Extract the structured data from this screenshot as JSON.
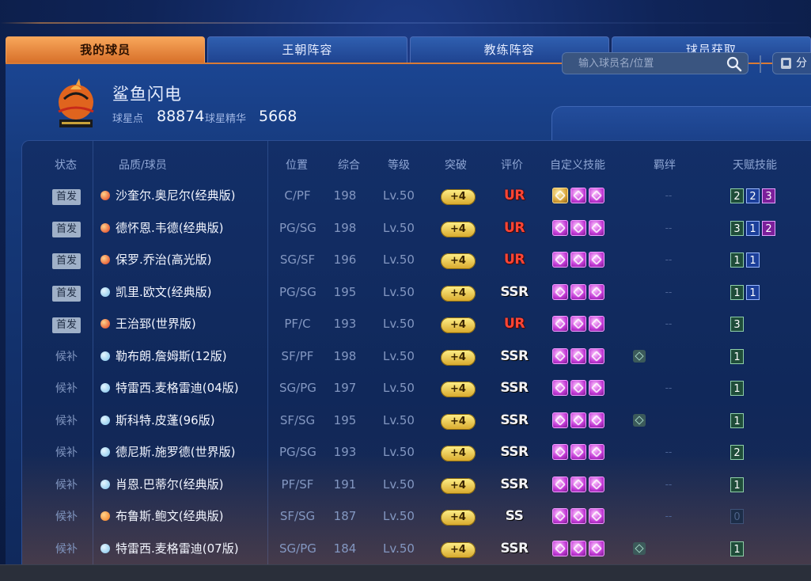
{
  "tabs": [
    {
      "label": "我的球员",
      "active": true
    },
    {
      "label": "王朝阵容",
      "active": false
    },
    {
      "label": "教练阵容",
      "active": false
    },
    {
      "label": "球员获取",
      "active": false
    }
  ],
  "team": {
    "name": "鲨鱼闪电",
    "star_points_label": "球星点",
    "star_points": "88874",
    "essence_label": "球星精华",
    "essence": "5668"
  },
  "search": {
    "placeholder": "输入球员名/位置"
  },
  "share_label": "分",
  "columns": [
    "状态",
    "品质/球员",
    "位置",
    "综合",
    "等级",
    "突破",
    "评价",
    "自定义技能",
    "羁绊",
    "天赋技能"
  ],
  "colors": {
    "accent": "#e08a3c",
    "quality_red": "#e03a1e",
    "quality_blue": "#7ec3ea",
    "quality_orange": "#f0791e",
    "rating_ur": "#ff4534"
  },
  "players": [
    {
      "status": "首发",
      "starter": true,
      "quality": "red",
      "name": "沙奎尔.奥尼尔(经典版)",
      "position": "C/PF",
      "overall": "198",
      "level": "Lv.50",
      "breakthrough": "+4",
      "rating": "UR",
      "skills": [
        "gold-skill",
        "skill",
        "skill"
      ],
      "bond": "--",
      "talents": [
        {
          "v": "2",
          "c": "g"
        },
        {
          "v": "2",
          "c": "b"
        },
        {
          "v": "3",
          "c": "p"
        }
      ]
    },
    {
      "status": "首发",
      "starter": true,
      "quality": "red",
      "name": "德怀恩.韦德(经典版)",
      "position": "PG/SG",
      "overall": "198",
      "level": "Lv.50",
      "breakthrough": "+4",
      "rating": "UR",
      "skills": [
        "skill",
        "skill",
        "skill"
      ],
      "bond": "--",
      "talents": [
        {
          "v": "3",
          "c": "g"
        },
        {
          "v": "1",
          "c": "b"
        },
        {
          "v": "2",
          "c": "p"
        }
      ]
    },
    {
      "status": "首发",
      "starter": true,
      "quality": "red",
      "name": "保罗.乔治(高光版)",
      "position": "SG/SF",
      "overall": "196",
      "level": "Lv.50",
      "breakthrough": "+4",
      "rating": "UR",
      "skills": [
        "skill",
        "skill",
        "skill"
      ],
      "bond": "--",
      "talents": [
        {
          "v": "1",
          "c": "g"
        },
        {
          "v": "1",
          "c": "b"
        }
      ]
    },
    {
      "status": "首发",
      "starter": true,
      "quality": "blue",
      "name": "凯里.欧文(经典版)",
      "position": "PG/SG",
      "overall": "195",
      "level": "Lv.50",
      "breakthrough": "+4",
      "rating": "SSR",
      "skills": [
        "skill",
        "skill",
        "skill"
      ],
      "bond": "--",
      "talents": [
        {
          "v": "1",
          "c": "g"
        },
        {
          "v": "1",
          "c": "b"
        }
      ]
    },
    {
      "status": "首发",
      "starter": true,
      "quality": "red",
      "name": "王治郅(世界版)",
      "position": "PF/C",
      "overall": "193",
      "level": "Lv.50",
      "breakthrough": "+4",
      "rating": "UR",
      "skills": [
        "skill",
        "skill",
        "skill"
      ],
      "bond": "--",
      "talents": [
        {
          "v": "3",
          "c": "g"
        }
      ]
    },
    {
      "status": "候补",
      "starter": false,
      "quality": "blue",
      "name": "勒布朗.詹姆斯(12版)",
      "position": "SF/PF",
      "overall": "198",
      "level": "Lv.50",
      "breakthrough": "+4",
      "rating": "SSR",
      "skills": [
        "skill",
        "skill",
        "skill"
      ],
      "bond": "icon",
      "talents": [
        {
          "v": "1",
          "c": "g"
        }
      ]
    },
    {
      "status": "候补",
      "starter": false,
      "quality": "blue",
      "name": "特雷西.麦格雷迪(04版)",
      "position": "SG/PG",
      "overall": "197",
      "level": "Lv.50",
      "breakthrough": "+4",
      "rating": "SSR",
      "skills": [
        "skill",
        "skill",
        "skill"
      ],
      "bond": "--",
      "talents": [
        {
          "v": "1",
          "c": "g"
        }
      ]
    },
    {
      "status": "候补",
      "starter": false,
      "quality": "blue",
      "name": "斯科特.皮蓬(96版)",
      "position": "SF/SG",
      "overall": "195",
      "level": "Lv.50",
      "breakthrough": "+4",
      "rating": "SSR",
      "skills": [
        "skill",
        "skill",
        "skill"
      ],
      "bond": "icon",
      "talents": [
        {
          "v": "1",
          "c": "g"
        }
      ]
    },
    {
      "status": "候补",
      "starter": false,
      "quality": "blue",
      "name": "德尼斯.施罗德(世界版)",
      "position": "PG/SG",
      "overall": "193",
      "level": "Lv.50",
      "breakthrough": "+4",
      "rating": "SSR",
      "skills": [
        "skill",
        "skill",
        "skill"
      ],
      "bond": "--",
      "talents": [
        {
          "v": "2",
          "c": "g"
        }
      ]
    },
    {
      "status": "候补",
      "starter": false,
      "quality": "blue",
      "name": "肖恩.巴蒂尔(经典版)",
      "position": "PF/SF",
      "overall": "191",
      "level": "Lv.50",
      "breakthrough": "+4",
      "rating": "SSR",
      "skills": [
        "skill",
        "skill",
        "skill"
      ],
      "bond": "--",
      "talents": [
        {
          "v": "1",
          "c": "g"
        }
      ]
    },
    {
      "status": "候补",
      "starter": false,
      "quality": "orange",
      "name": "布鲁斯.鲍文(经典版)",
      "position": "SF/SG",
      "overall": "187",
      "level": "Lv.50",
      "breakthrough": "+4",
      "rating": "SS",
      "skills": [
        "skill",
        "skill",
        "skill"
      ],
      "bond": "--",
      "talents": [
        {
          "v": "0",
          "c": "z"
        }
      ]
    },
    {
      "status": "候补",
      "starter": false,
      "quality": "blue",
      "name": "特雷西.麦格雷迪(07版)",
      "position": "SG/PG",
      "overall": "184",
      "level": "Lv.50",
      "breakthrough": "+4",
      "rating": "SSR",
      "skills": [
        "skill",
        "skill",
        "skill"
      ],
      "bond": "icon",
      "talents": [
        {
          "v": "1",
          "c": "g"
        }
      ]
    }
  ]
}
